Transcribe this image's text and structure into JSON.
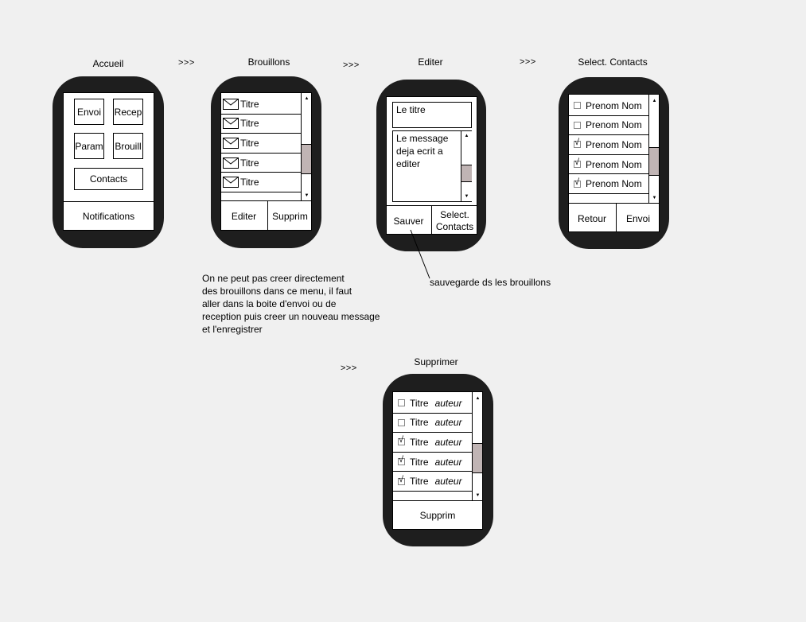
{
  "arrows": [
    ">>>",
    ">>>",
    ">>>",
    ">>>"
  ],
  "accueil": {
    "title": "Accueil",
    "buttons": {
      "envoi": "Envoi",
      "recep": "Recep",
      "param": "Param",
      "brouill": "Brouill",
      "contacts": "Contacts"
    },
    "notifications": "Notifications"
  },
  "brouillons": {
    "title": "Brouillons",
    "items": [
      "Titre",
      "Titre",
      "Titre",
      "Titre",
      "Titre"
    ],
    "edit": "Editer",
    "delete": "Supprim"
  },
  "editer": {
    "title": "Editer",
    "title_field": "Le titre",
    "message_lines": [
      "Le message",
      "deja ecrit a",
      "editer"
    ],
    "save": "Sauver",
    "select_lines": [
      "Select.",
      "Contacts"
    ]
  },
  "select_contacts": {
    "title": "Select. Contacts",
    "contacts": [
      {
        "name": "Prenom Nom",
        "checked": false
      },
      {
        "name": "Prenom Nom",
        "checked": false
      },
      {
        "name": "Prenom Nom",
        "checked": true
      },
      {
        "name": "Prenom Nom",
        "checked": true
      },
      {
        "name": "Prenom Nom",
        "checked": true
      }
    ],
    "back": "Retour",
    "send": "Envoi"
  },
  "supprimer": {
    "title": "Supprimer",
    "items": [
      {
        "title": "Titre",
        "author": "auteur",
        "checked": false
      },
      {
        "title": "Titre",
        "author": "auteur",
        "checked": false
      },
      {
        "title": "Titre",
        "author": "auteur",
        "checked": true
      },
      {
        "title": "Titre",
        "author": "auteur",
        "checked": true
      },
      {
        "title": "Titre",
        "author": "auteur",
        "checked": true
      }
    ],
    "delete": "Supprim"
  },
  "annotations": {
    "drafts_note": [
      "On ne peut pas creer directement",
      "des brouillons dans ce menu, il faut",
      "aller dans la boite d'envoi ou de",
      "reception puis creer un nouveau message",
      "et l'enregistrer"
    ],
    "save_note": "sauvegarde ds les brouillons"
  },
  "icons": {
    "envelope": "envelope-icon",
    "checkmark": "√",
    "scroll_up": "▲",
    "scroll_down": "▼"
  },
  "colors": {
    "background": "#f0f0f0",
    "watch_body": "#1e1e1e",
    "scroll_thumb": "#c0b4b4"
  }
}
